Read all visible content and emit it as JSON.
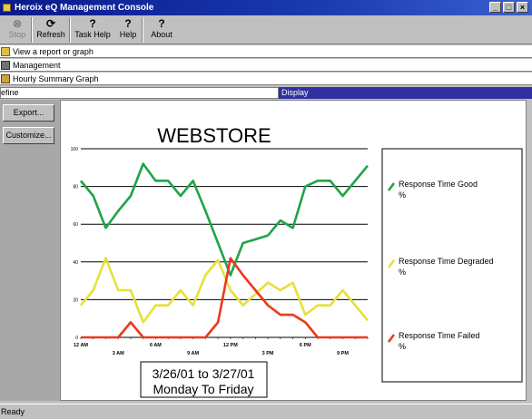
{
  "window": {
    "title": "Heroix eQ Management Console"
  },
  "toolbar": {
    "stop": {
      "label": "Stop",
      "icon": "stop-icon"
    },
    "refresh": {
      "label": "Refresh",
      "icon": "refresh-icon"
    },
    "task_help": {
      "label": "Task Help",
      "icon": "help-icon"
    },
    "help": {
      "label": "Help",
      "icon": "help-icon"
    },
    "about": {
      "label": "About",
      "icon": "help-icon"
    }
  },
  "nav": {
    "row1": "View a report or graph",
    "row2": "Management",
    "row3": "Hourly Summary Graph"
  },
  "tabs": {
    "define": "efine",
    "display": "Display"
  },
  "side": {
    "export": "Export...",
    "customize": "Customize..."
  },
  "status": "Ready",
  "colors": {
    "good": "#1fa447",
    "degraded": "#e8e03a",
    "failed": "#e83a1e",
    "tab_active": "#3030a0"
  },
  "chart_data": {
    "type": "line",
    "title": "WEBSTORE",
    "ylim": [
      0,
      100
    ],
    "yticks": [
      "0",
      "20",
      "40",
      "60",
      "80",
      "100"
    ],
    "xticks_upper": [
      "12 AM",
      "6 AM",
      "12 PM",
      "6 PM"
    ],
    "xticks_lower": [
      "3 AM",
      "9 AM",
      "3 PM",
      "9 PM"
    ],
    "x_hours": [
      0,
      1,
      2,
      3,
      4,
      5,
      6,
      7,
      8,
      9,
      10,
      11,
      12,
      13,
      14,
      15,
      16,
      17,
      18,
      19,
      20,
      21,
      22,
      23
    ],
    "grid": true,
    "legend": "right",
    "series": [
      {
        "name": "Response Time Good %",
        "color": "#1fa447",
        "values": [
          83,
          75,
          58,
          67,
          75,
          92,
          83,
          83,
          75,
          83,
          67,
          50,
          33,
          50,
          52,
          54,
          62,
          58,
          80,
          83,
          83,
          75,
          83,
          91
        ]
      },
      {
        "name": "Response Time Degraded %",
        "color": "#e8e03a",
        "values": [
          17,
          25,
          42,
          25,
          25,
          8,
          17,
          17,
          25,
          17,
          33,
          41,
          25,
          17,
          23,
          29,
          25,
          29,
          12,
          17,
          17,
          25,
          17,
          9
        ]
      },
      {
        "name": "Response Time Failed %",
        "color": "#e83a1e",
        "values": [
          0,
          0,
          0,
          0,
          8,
          0,
          0,
          0,
          0,
          0,
          0,
          8,
          42,
          33,
          25,
          17,
          12,
          12,
          8,
          0,
          0,
          0,
          0,
          0
        ]
      }
    ],
    "date_range": "3/26/01 to 3/27/01",
    "day_range": "Monday To Friday"
  }
}
